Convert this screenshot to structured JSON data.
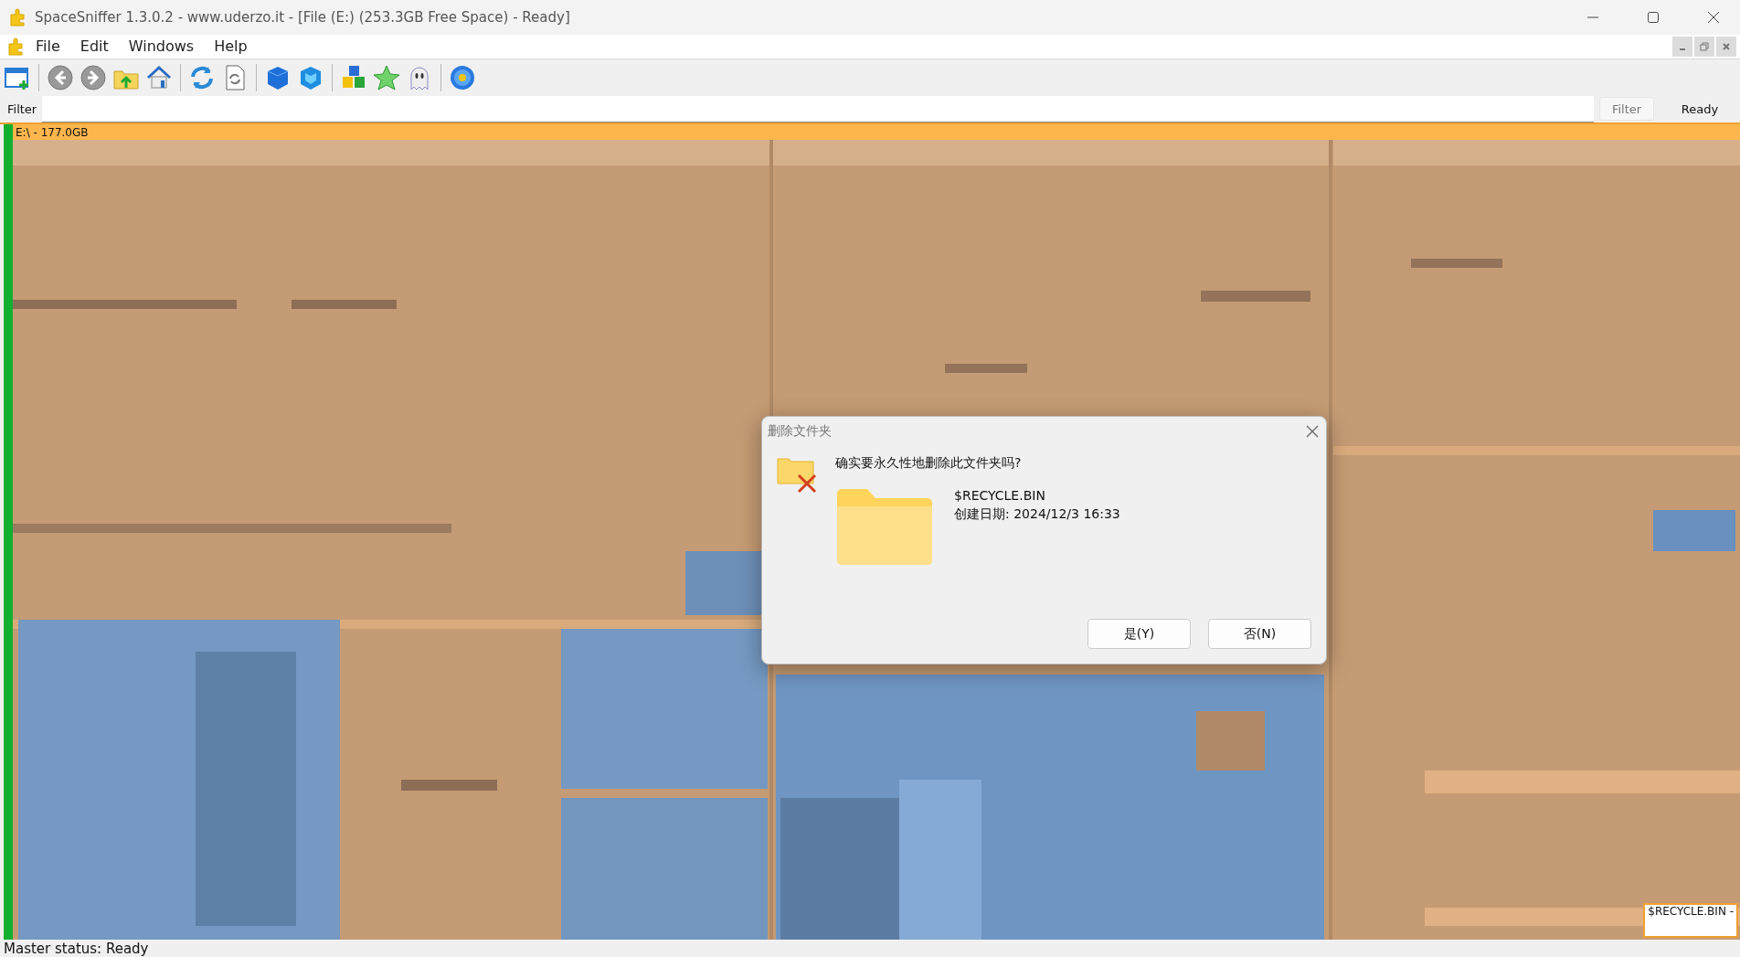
{
  "window": {
    "title": "SpaceSniffer 1.3.0.2 - www.uderzo.it - [File (E:) (253.3GB Free Space) - Ready]"
  },
  "menu": [
    "File",
    "Edit",
    "Windows",
    "Help"
  ],
  "filter_bar": {
    "label": "Filter",
    "button": "Filter",
    "status": "Ready"
  },
  "treemap": {
    "header": "E:\\ - 177.0GB",
    "tooltip": "$RECYCLE.BIN -"
  },
  "dialog": {
    "title": "删除文件夹",
    "question": "确实要永久性地删除此文件夹吗?",
    "item_name": "$RECYCLE.BIN",
    "item_detail": "创建日期: 2024/12/3 16:33",
    "buttons": [
      "是(Y)",
      "否(N)"
    ]
  },
  "status_bar": "Master status: Ready"
}
